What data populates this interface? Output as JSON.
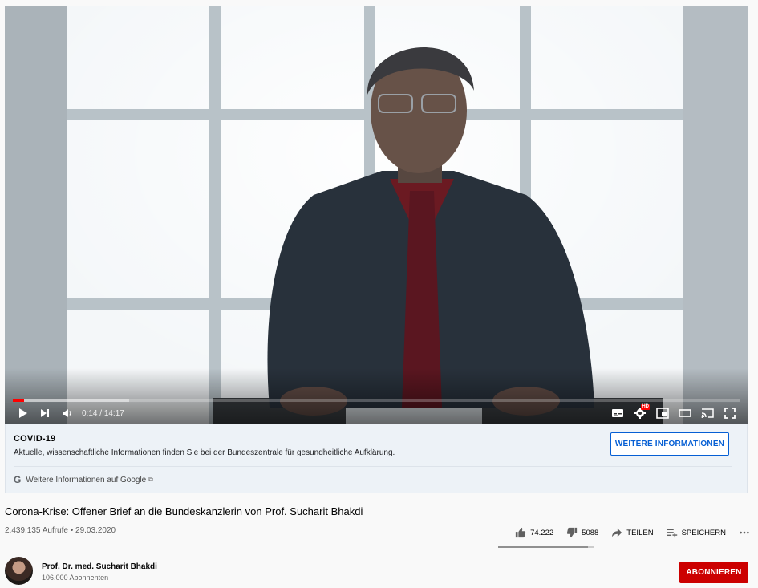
{
  "player": {
    "time_current": "0:14",
    "time_separator": " / ",
    "time_total": "14:17",
    "progress_played_fraction": 0.016,
    "progress_loaded_fraction": 0.16,
    "hd_badge": "HD"
  },
  "info_panel": {
    "title": "COVID-19",
    "text": "Aktuelle, wissenschaftliche Informationen finden Sie bei der Bundeszentrale für gesundheitliche Aufklärung.",
    "button_label": "WEITERE INFORMATIONEN",
    "google_link": "Weitere Informationen auf Google",
    "google_letter": "G"
  },
  "video": {
    "title": "Corona-Krise: Offener Brief an die Bundeskanzlerin von Prof. Sucharit Bhakdi",
    "views_date": "2.439.135 Aufrufe • 29.03.2020",
    "likes": "74.222",
    "dislikes": "5088",
    "share_label": "TEILEN",
    "save_label": "SPEICHERN",
    "like_fraction": 0.936
  },
  "channel": {
    "name": "Prof. Dr. med. Sucharit Bhakdi",
    "subscribers": "106.000 Abonnenten",
    "subscribe_label": "ABONNIEREN"
  },
  "colors": {
    "accent_red": "#cc0000",
    "link_blue": "#065fd4",
    "progress_red": "#ff0000"
  },
  "icons": [
    "play-icon",
    "next-icon",
    "volume-icon",
    "subtitles-icon",
    "settings-icon",
    "miniplayer-icon",
    "theater-icon",
    "cast-icon",
    "fullscreen-icon",
    "like-icon",
    "dislike-icon",
    "share-icon",
    "save-icon",
    "more-icon",
    "external-link-icon",
    "google-icon"
  ]
}
